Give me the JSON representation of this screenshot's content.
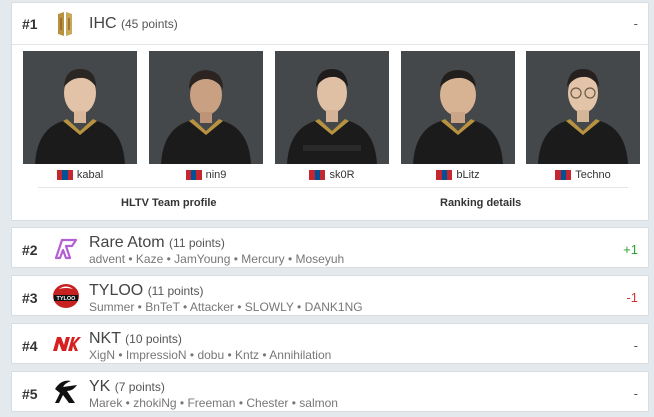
{
  "colors": {
    "up": "#2e9e2e",
    "down": "#d33333",
    "flag_red": "#c4272f",
    "flag_blue": "#015197",
    "jersey": "#1b1b1b",
    "gold": "#b8923e"
  },
  "teams": [
    {
      "rank": "#1",
      "name": "IHC",
      "points": "(45 points)",
      "change": "-",
      "logo_icon": "ihc-logo-icon",
      "players": [
        "kabal",
        "nin9",
        "sk0R",
        "bLitz",
        "Techno"
      ],
      "links": {
        "team_profile": "HLTV Team profile",
        "ranking_details": "Ranking details"
      }
    },
    {
      "rank": "#2",
      "name": "Rare Atom",
      "points": "(11 points)",
      "change": "+1",
      "logo_icon": "rare-atom-logo-icon",
      "roster": [
        "advent",
        "Kaze",
        "JamYoung",
        "Mercury",
        "Moseyuh"
      ]
    },
    {
      "rank": "#3",
      "name": "TYLOO",
      "points": "(11 points)",
      "change": "-1",
      "logo_icon": "tyloo-logo-icon",
      "roster": [
        "Summer",
        "BnTeT",
        "Attacker",
        "SLOWLY",
        "DANK1NG"
      ]
    },
    {
      "rank": "#4",
      "name": "NKT",
      "points": "(10 points)",
      "change": "-",
      "logo_icon": "nkt-logo-icon",
      "roster": [
        "XigN",
        "ImpressioN",
        "dobu",
        "Kntz",
        "Annihilation"
      ]
    },
    {
      "rank": "#5",
      "name": "YK",
      "points": "(7 points)",
      "change": "-",
      "logo_icon": "yk-logo-icon",
      "roster": [
        "Marek",
        "zhokiNg",
        "Freeman",
        "Chester",
        "salmon"
      ]
    }
  ]
}
